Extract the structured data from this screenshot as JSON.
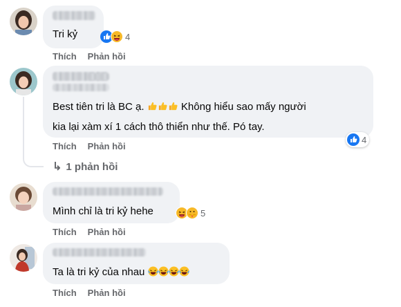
{
  "comments": [
    {
      "text": "Tri kỷ",
      "reactions": {
        "count": "4",
        "icons": [
          "like-icon",
          "haha-icon"
        ]
      },
      "actions": {
        "like": "Thích",
        "reply": "Phản hồi"
      }
    },
    {
      "text_line1": "Best tiên tri là BC ạ.",
      "text_line1_after": "Không hiểu sao mấy người",
      "text_line2": "kia lại xàm xí 1 cách thô thiển như thế. Pó tay.",
      "emojis": [
        "thumbs-up-emoji",
        "thumbs-up-emoji",
        "thumbs-up-emoji"
      ],
      "reactions": {
        "count": "4",
        "icons": [
          "like-icon"
        ]
      },
      "actions": {
        "like": "Thích",
        "reply": "Phản hồi"
      },
      "replies_label": "1 phản hồi"
    },
    {
      "text": "Mình chỉ là tri kỷ hehe",
      "reactions": {
        "count": "5",
        "icons": [
          "haha-icon",
          "care-icon"
        ]
      },
      "actions": {
        "like": "Thích",
        "reply": "Phản hồi"
      }
    },
    {
      "text": "Ta là tri kỷ của nhau",
      "emojis": [
        "joy-emoji",
        "joy-emoji",
        "joy-emoji",
        "joy-emoji"
      ],
      "actions": {
        "like": "Thích",
        "reply": "Phản hồi"
      }
    }
  ],
  "colors": {
    "bubble": "#f0f2f5",
    "like_blue": "#1877f2",
    "haha_yellow": "#f7b928",
    "secondary_text": "#65676b"
  }
}
